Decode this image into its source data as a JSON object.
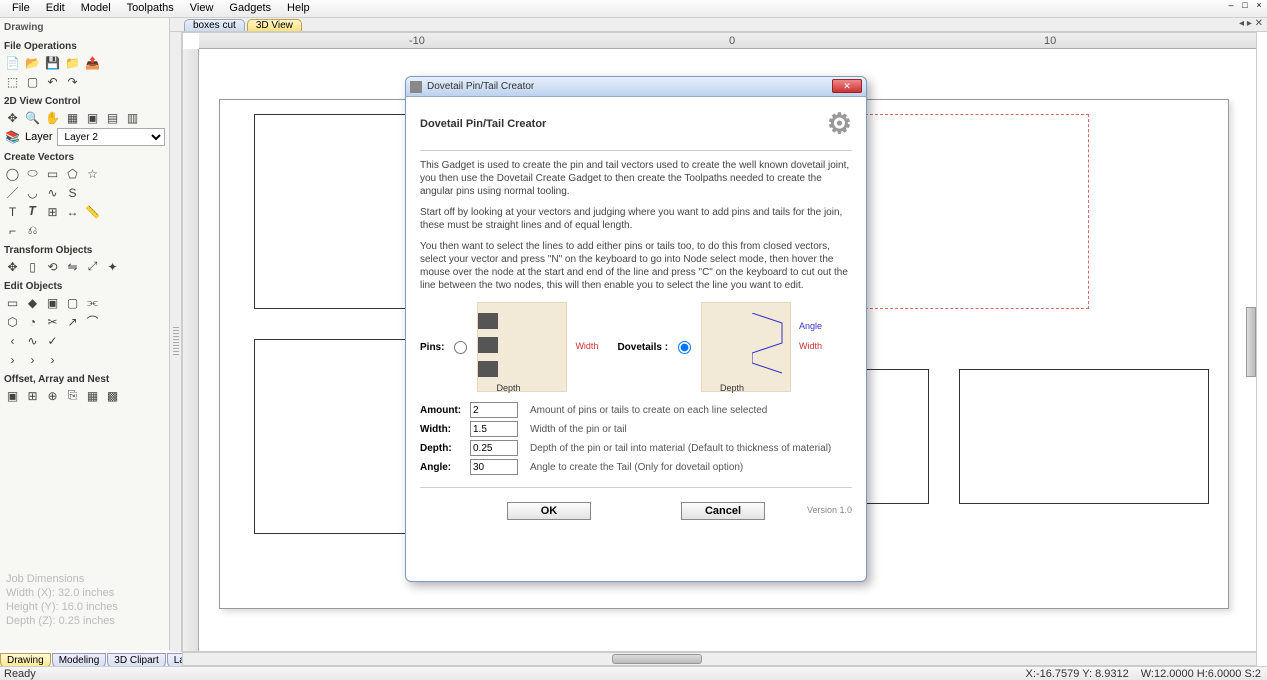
{
  "menu": [
    "File",
    "Edit",
    "Model",
    "Toolpaths",
    "View",
    "Gadgets",
    "Help"
  ],
  "panel_title": "Drawing",
  "sections": {
    "file_ops": "File Operations",
    "view2d": "2D View Control",
    "layer_label": "Layer",
    "layer_value": "Layer 2",
    "create_vectors": "Create Vectors",
    "transform": "Transform Objects",
    "edit": "Edit Objects",
    "offset": "Offset, Array and Nest"
  },
  "job_dims": {
    "title": "Job Dimensions",
    "w": "Width  (X): 32.0 inches",
    "h": "Height (Y): 16.0 inches",
    "d": "Depth  (Z): 0.25 inches"
  },
  "bottom_tabs": [
    "Drawing",
    "Modeling",
    "3D Clipart",
    "Layers"
  ],
  "view_tabs": [
    "boxes cut",
    "3D View"
  ],
  "ruler": {
    "m10": "-10",
    "zero": "0",
    "p10": "10"
  },
  "dialog": {
    "title": "Dovetail Pin/Tail Creator",
    "heading": "Dovetail Pin/Tail Creator",
    "p1": "This Gadget is used to create the pin and tail vectors used to create the well known dovetail joint, you then use the Dovetail Create Gadget to then create the Toolpaths needed to create the angular pins using normal tooling.",
    "p2": "Start off by looking at your vectors and judging where you want to add pins and tails for the join, these must be straight lines and of equal length.",
    "p3": "You then want to select the lines to add either pins or tails too, to do this from closed vectors, select your vector and press \"N\" on the keyboard to go into Node select mode, then hover the mouse over the node at the start and end of the line and press \"C\" on the keyboard to cut out the line between the two nodes, this will then enable you to select the line you want to edit.",
    "pins_label": "Pins:",
    "dovetails_label": "Dovetails :",
    "fig": {
      "width": "Width",
      "depth": "Depth",
      "angle": "Angle"
    },
    "fields": {
      "amount_label": "Amount:",
      "amount_val": "2",
      "amount_hint": "Amount of pins or tails to create on each line selected",
      "width_label": "Width:",
      "width_val": "1.5",
      "width_hint": "Width of the pin or tail",
      "depth_label": "Depth:",
      "depth_val": "0.25",
      "depth_hint": "Depth of the pin or tail into material (Default to thickness of material)",
      "angle_label": "Angle:",
      "angle_val": "30",
      "angle_hint": "Angle to create the Tail (Only for dovetail option)"
    },
    "ok": "OK",
    "cancel": "Cancel",
    "version": "Version 1.0"
  },
  "status": {
    "ready": "Ready",
    "xy": "X:-16.7579  Y: 8.9312",
    "wh": "W:12.0000  H:6.0000  S:2"
  }
}
